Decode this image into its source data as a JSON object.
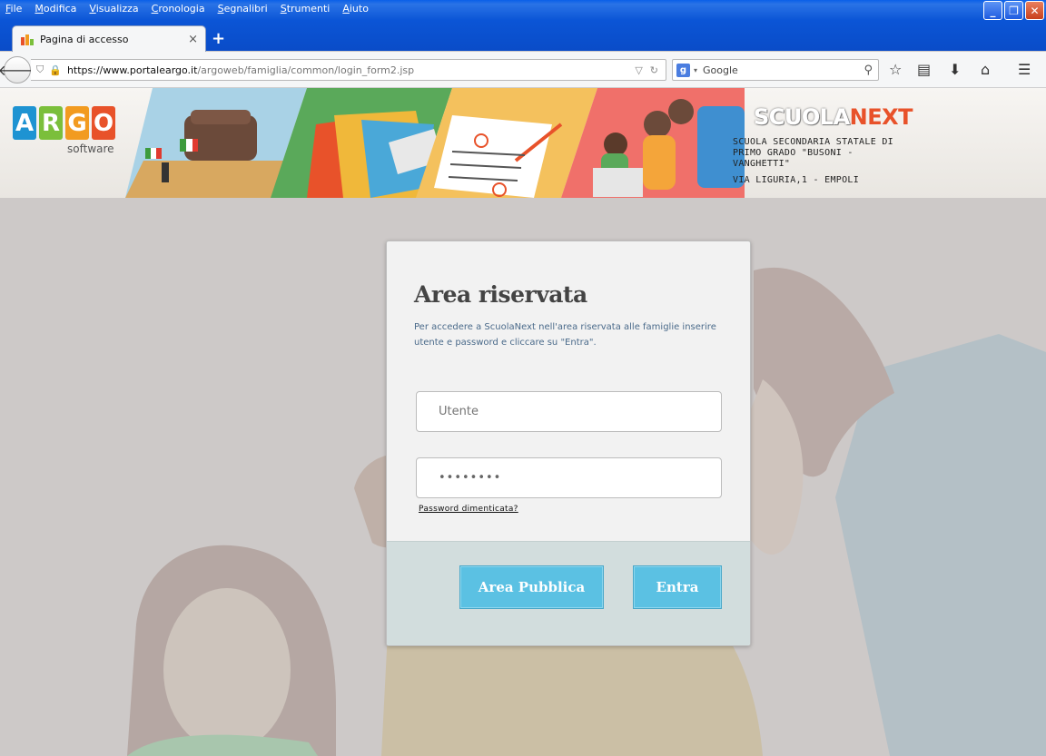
{
  "browser": {
    "menu": [
      "File",
      "Modifica",
      "Visualizza",
      "Cronologia",
      "Segnalibri",
      "Strumenti",
      "Aiuto"
    ],
    "tab_title": "Pagina di accesso",
    "tab_close": "×",
    "new_tab": "+",
    "url_host": "https://www.portaleargo.it",
    "url_path": "/argoweb/famiglia/common/login_form2.jsp",
    "search_engine": "Google",
    "search_placeholder": "Google",
    "icons": [
      "back-arrow-icon",
      "shield-icon",
      "lock-icon",
      "dropdown-arrow-icon",
      "reload-icon",
      "search-icon",
      "star-icon",
      "reading-list-icon",
      "download-icon",
      "home-icon",
      "hamburger-menu-icon"
    ]
  },
  "header": {
    "logo_letters": [
      "A",
      "R",
      "G",
      "O"
    ],
    "logo_colors": [
      "#1e93d2",
      "#7bbf3b",
      "#f29b20",
      "#e8522a"
    ],
    "logo_sub": "software",
    "brand_a": "SCUOLA",
    "brand_b": "NEXT",
    "school_name": "SCUOLA SECONDARIA STATALE DI PRIMO GRADO \"BUSONI - VANGHETTI\"",
    "school_address": "VIA LIGURIA,1 - EMPOLI"
  },
  "login": {
    "title": "Area riservata",
    "description": "Per accedere a ScuolaNext nell'area riservata alle famiglie inserire utente e password e cliccare su \"Entra\".",
    "user_placeholder": "Utente",
    "password_value": "••••••••",
    "forgot_link": "Password dimenticata?",
    "public_button": "Area Pubblica",
    "enter_button": "Entra"
  },
  "colors": {
    "accent_button": "#5bc1e3",
    "card_footer": "#d2dddd",
    "page_bg": "#cdc9c8",
    "titlebar": "#0b55d6"
  }
}
